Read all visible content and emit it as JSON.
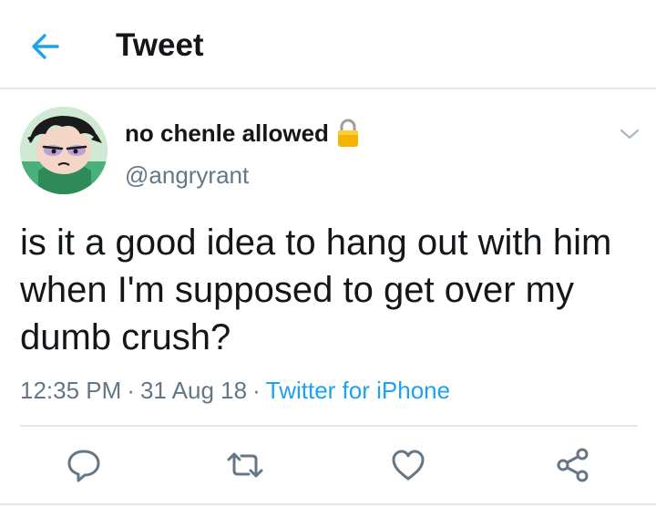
{
  "header": {
    "title": "Tweet",
    "back_icon": "arrow-left-icon"
  },
  "author": {
    "name": "no chenle allowed",
    "handle": "@angryrant",
    "protected_icon": "lock-icon",
    "avatar": "avatar-image"
  },
  "tweet": {
    "text": "is it a good idea to hang out with him when I'm supposed to get over my dumb crush?",
    "time": "12:35 PM",
    "date": "31 Aug 18",
    "source": "Twitter for iPhone",
    "separator": "·"
  },
  "actions": [
    {
      "name": "reply",
      "icon": "reply-icon"
    },
    {
      "name": "retweet",
      "icon": "retweet-icon"
    },
    {
      "name": "like",
      "icon": "heart-icon"
    },
    {
      "name": "share",
      "icon": "share-icon"
    }
  ],
  "colors": {
    "accent": "#1da1f2",
    "secondary_text": "#657786",
    "primary_text": "#14171a",
    "border": "#e1e8ed",
    "lock": "#f5b400"
  }
}
